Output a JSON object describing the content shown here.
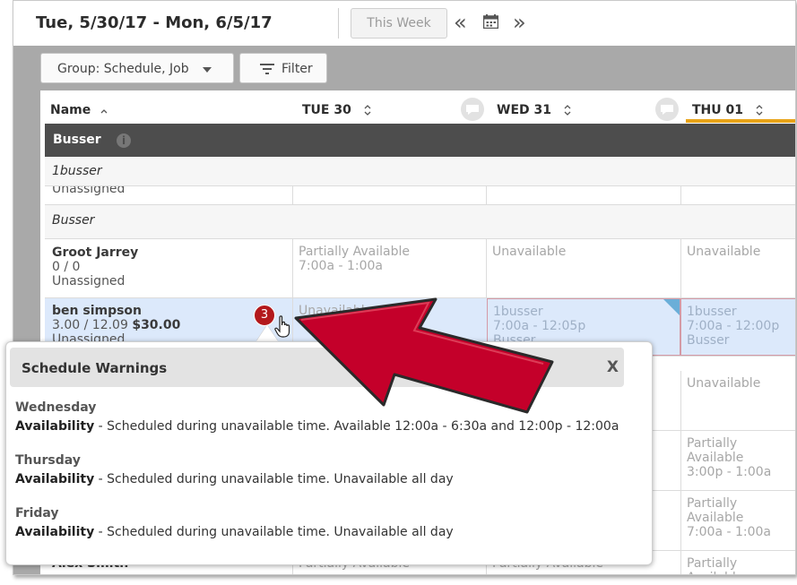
{
  "header": {
    "date_range": "Tue, 5/30/17 - Mon, 6/5/17",
    "this_week": "This Week",
    "prev_glyph": "«",
    "next_glyph": "»"
  },
  "toolbar": {
    "group_label": "Group: Schedule, Job",
    "filter_label": "Filter"
  },
  "columns": {
    "name": "Name",
    "tue": "TUE 30",
    "wed": "WED 31",
    "thu": "THU 01"
  },
  "groups": {
    "busser_title": "Busser",
    "info": "i",
    "sub1": "1busser",
    "sub1_partial": "Unassigned",
    "sub2": "Busser"
  },
  "rows": [
    {
      "name": "Groot Jarrey",
      "hours": "0 / 0",
      "status": "Unassigned",
      "tue1": "Partially Available",
      "tue2": "7:00a - 1:00a",
      "wed1": "Unavailable",
      "thu1": "Unavailable"
    },
    {
      "name": "ben simpson",
      "hours": "3.00 / 12.09",
      "wage": "$30.00",
      "status": "Unassigned",
      "tue1": "Unavailable",
      "wed1": "1busser",
      "wed2": "7:00a - 12:05p",
      "wed3": "Busser",
      "thu1": "1busser",
      "thu2": "7:00a - 12:00p",
      "thu3": "Busser"
    }
  ],
  "right_column": {
    "r3": "Unavailable",
    "r4a": "Partially Available",
    "r4b": "3:00p - 1:00a",
    "r5a": "Partially Available",
    "r5b": "7:00a - 1:00a",
    "r6a": "Partially Available"
  },
  "bottom_row": {
    "name": "Alex Smith",
    "tue": "Partially Available",
    "wed": "Partially Available"
  },
  "badge_count": "3",
  "warnings": {
    "title": "Schedule Warnings",
    "close": "X",
    "items": [
      {
        "day": "Wednesday",
        "label": "Availability",
        "text": " - Scheduled during unavailable time. Available 12:00a - 6:30a and 12:00p - 12:00a"
      },
      {
        "day": "Thursday",
        "label": "Availability",
        "text": " - Scheduled during unavailable time. Unavailable all day"
      },
      {
        "day": "Friday",
        "label": "Availability",
        "text": " - Scheduled during unavailable time. Unavailable all day"
      }
    ]
  },
  "colors": {
    "accent_orange": "#e8a318",
    "badge_red": "#b3191c",
    "arrow_red": "#c4002a",
    "band_dark": "#4d4d4d"
  }
}
